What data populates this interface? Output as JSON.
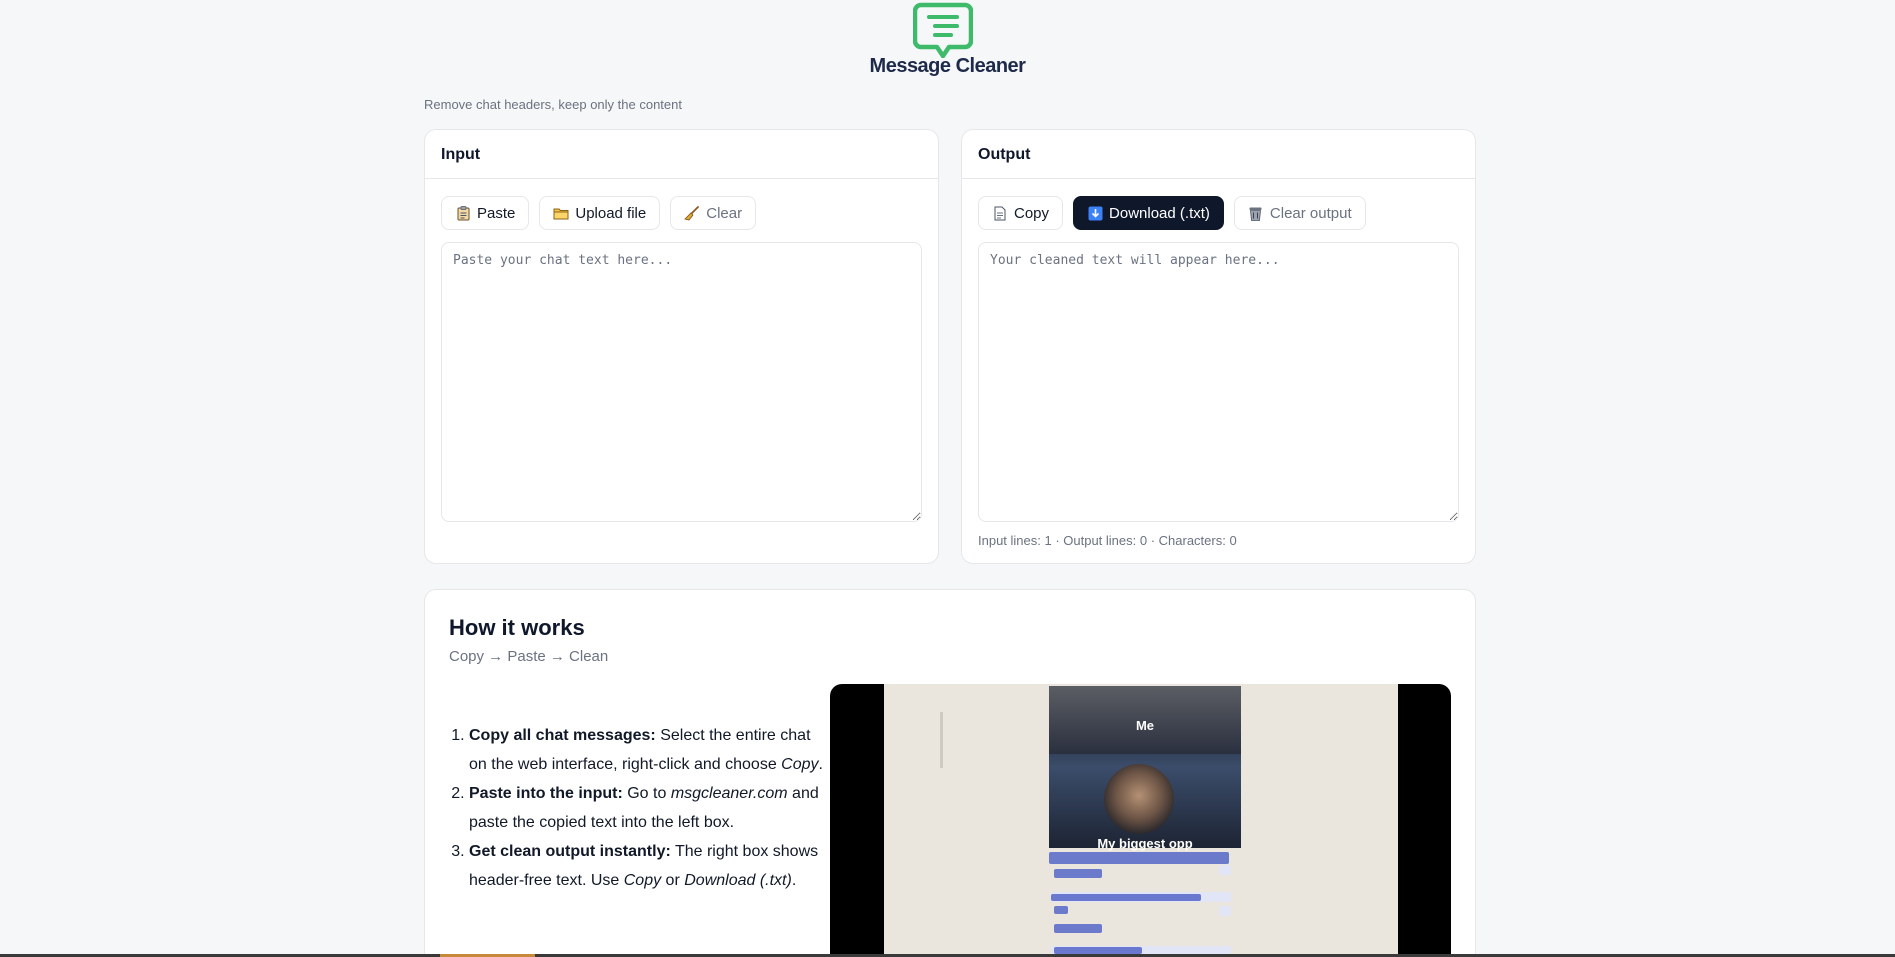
{
  "brand": {
    "name": "Message Cleaner",
    "tagline": "Remove chat headers, keep only the content",
    "logo_icon": "chat-bubble-lines-icon",
    "accent": "#3dbb6b"
  },
  "input": {
    "title": "Input",
    "buttons": {
      "paste": "Paste",
      "upload": "Upload file",
      "clear": "Clear"
    },
    "icons": {
      "paste": "clipboard-icon",
      "upload": "folder-icon",
      "clear": "broom-icon"
    },
    "placeholder": "Paste your chat text here...",
    "value": ""
  },
  "output": {
    "title": "Output",
    "buttons": {
      "copy": "Copy",
      "download": "Download (.txt)",
      "clear": "Clear output"
    },
    "icons": {
      "copy": "page-icon",
      "download": "download-arrow-icon",
      "clear": "trash-can-icon"
    },
    "placeholder": "Your cleaned text will appear here...",
    "value": "",
    "stats": "Input lines: 1 · Output lines: 0 · Characters: 0"
  },
  "how": {
    "title": "How it works",
    "subtitle": "Copy → Paste → Clean",
    "steps": [
      {
        "bold": "Copy all chat messages:",
        "text": " Select the entire chat on the web interface, right-click and choose ",
        "italic": "Copy",
        "tail": "."
      },
      {
        "bold": "Paste into the input:",
        "text": " Go to ",
        "italic": "msgcleaner.com",
        "tail": " and paste the copied text into the left box."
      },
      {
        "bold": "Get clean output instantly:",
        "text": " The right box shows header-free text. Use ",
        "italic": "Copy",
        "mid": " or ",
        "italic2": "Download (.txt)",
        "tail": "."
      }
    ],
    "media": {
      "meme_top": "Me",
      "meme_bottom": "My biggest opp"
    }
  },
  "colors": {
    "dark_button": "#0f172a",
    "border": "#e5e7eb",
    "muted_text": "#6b7280"
  }
}
